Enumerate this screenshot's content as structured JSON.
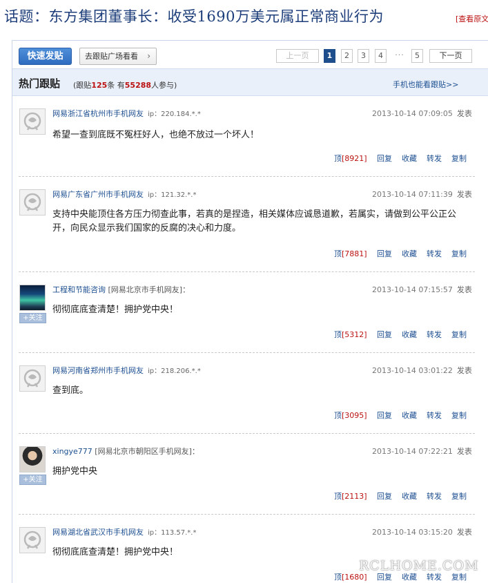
{
  "topic": {
    "title": "话题：东方集团董事长：收受1690万美元属正常商业行为",
    "source_link": "[查看原文"
  },
  "toolbar": {
    "post_button": "快速发贴",
    "plaza_button": "去跟贴广场看看",
    "pager": {
      "prev": "上一页",
      "pages": [
        "1",
        "2",
        "3",
        "4"
      ],
      "ellipsis": "···",
      "last": "5",
      "next": "下一页",
      "current": "1"
    }
  },
  "hot": {
    "title": "热门跟贴",
    "stats_prefix": "(跟贴",
    "post_count": "125",
    "stats_mid": "条 有",
    "participants": "55288",
    "stats_suffix": "人参与)",
    "mobile_link": "手机也能看跟贴>>"
  },
  "posts": [
    {
      "user": "网易浙江省杭州市手机网友",
      "ip": "ip：220.184.*.*",
      "time": "2013-10-14 07:09:05",
      "publish": "发表",
      "body": "希望一查到底既不冤枉好人，也绝不放过一个坏人！",
      "up_label": "顶",
      "up_count": "[8921]",
      "avatar": "default-avatar-icon"
    },
    {
      "user": "网易广东省广州市手机网友",
      "ip": "ip：121.32.*.*",
      "time": "2013-10-14 07:11:39",
      "publish": "发表",
      "body": "支持中央能顶住各方压力彻查此事，若真的是捏造，相关媒体应诚恳道歉，若属实，请做到公平公正公开，向民众显示我们国家的反腐的决心和力度。",
      "up_label": "顶",
      "up_count": "[7881]",
      "avatar": "default-avatar-icon"
    },
    {
      "user": "工程和节能咨询",
      "user_suffix": "[网易北京市手机网友]：",
      "time": "2013-10-14 07:15:57",
      "publish": "发表",
      "body": "彻彻底底查清楚！拥护党中央！",
      "up_label": "顶",
      "up_count": "[5312]",
      "avatar": "aurora-photo",
      "follow": "+关注"
    },
    {
      "user": "网易河南省郑州市手机网友",
      "ip": "ip：218.206.*.*",
      "time": "2013-10-14 03:01:22",
      "publish": "发表",
      "body": "查到底。",
      "up_label": "顶",
      "up_count": "[3095]",
      "avatar": "default-avatar-icon"
    },
    {
      "user": "xingye777",
      "user_suffix": "[网易北京市朝阳区手机网友]：",
      "time": "2013-10-14 07:22:21",
      "publish": "发表",
      "body": "拥护党中央",
      "up_label": "顶",
      "up_count": "[2113]",
      "avatar": "person-photo",
      "follow": "+关注"
    },
    {
      "user": "网易湖北省武汉市手机网友",
      "ip": "ip：113.57.*.*",
      "time": "2013-10-14 03:15:20",
      "publish": "发表",
      "body": "彻彻底底查清楚！拥护党中央！",
      "up_label": "顶",
      "up_count": "[1680]",
      "avatar": "default-avatar-icon"
    }
  ],
  "actions": {
    "reply": "回复",
    "favorite": "收藏",
    "forward": "转发",
    "copy": "复制"
  },
  "watermark": "RCLHOME.COM",
  "colors": {
    "link_blue": "#1d4f91",
    "count_red": "#bb1111",
    "header_bg": "#e9f0fa",
    "button_blue": "#2f6cc0"
  }
}
